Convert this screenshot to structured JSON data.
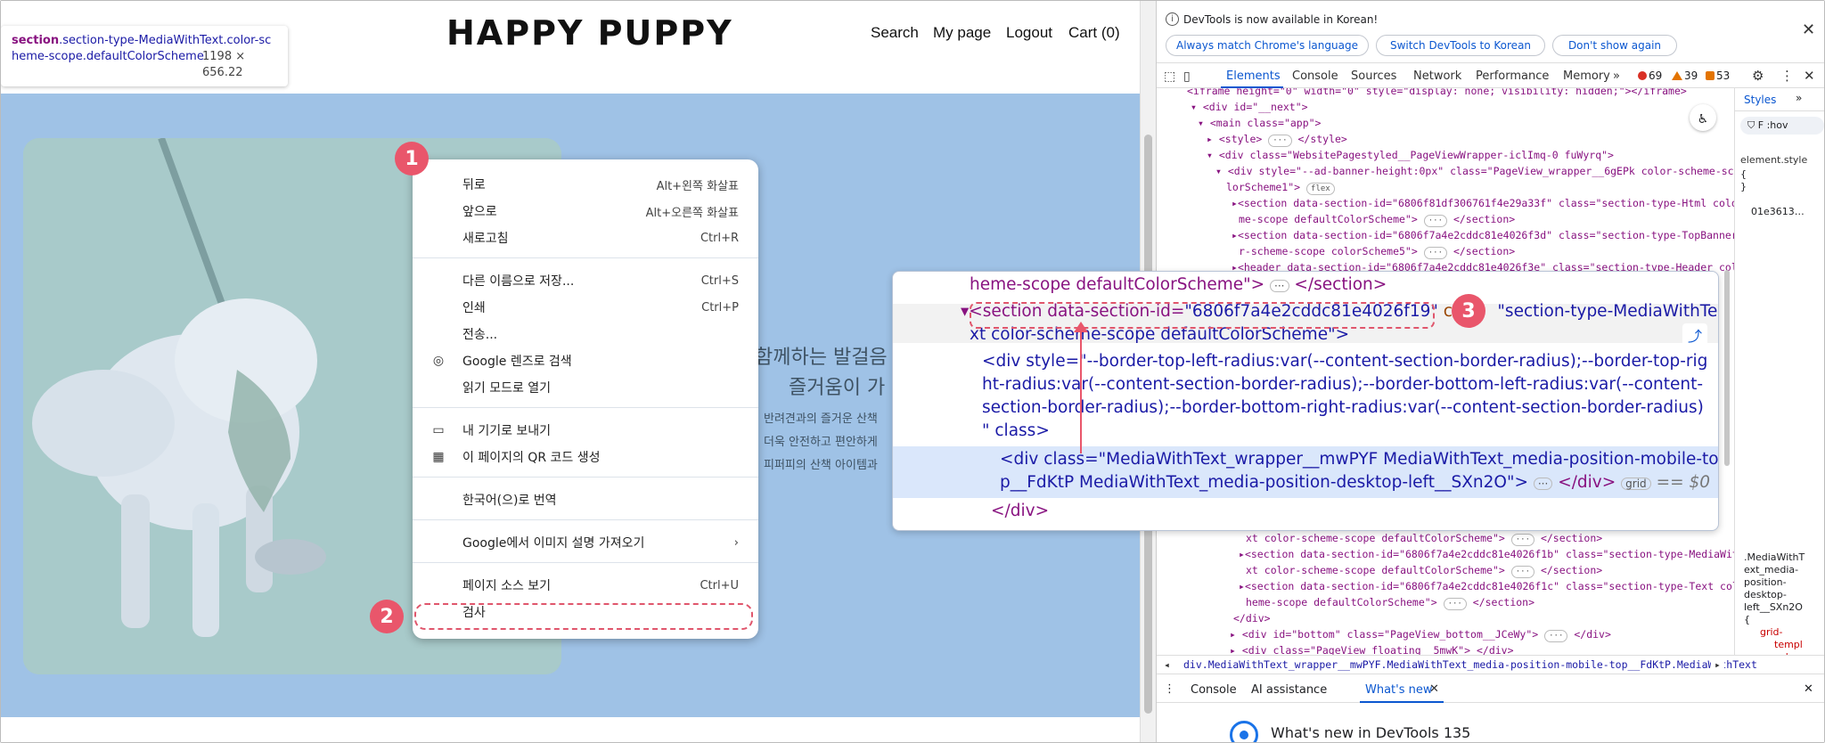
{
  "site": {
    "logo": "HAPPY PUPPY",
    "nav": {
      "search": "Search",
      "mypage": "My page",
      "logout": "Logout",
      "cart": "Cart (0)"
    },
    "hero_lines": [
      "함께하는 발걸음",
      "즐거움이 가",
      "반려견과의 즐거운 산책",
      "더욱 안전하고 편안하게",
      "피퍼피의 산책 아이템과"
    ],
    "inspect_tip": {
      "selector_tag": "section",
      "selector_rest": ".section-type-MediaWithText.color-scheme-scope.defaultColorScheme",
      "dims": "1198 × 656.22"
    }
  },
  "context_menu": {
    "items": [
      {
        "label": "뒤로",
        "shortcut": "Alt+왼쪽 화살표"
      },
      {
        "label": "앞으로",
        "shortcut": "Alt+오른쪽 화살표"
      },
      {
        "label": "새로고침",
        "shortcut": "Ctrl+R"
      },
      {
        "label": "다른 이름으로 저장...",
        "shortcut": "Ctrl+S"
      },
      {
        "label": "인쇄",
        "shortcut": "Ctrl+P"
      },
      {
        "label": "전송...",
        "shortcut": ""
      },
      {
        "label": "Google 렌즈로 검색",
        "shortcut": ""
      },
      {
        "label": "읽기 모드로 열기",
        "shortcut": ""
      },
      {
        "label": "내 기기로 보내기",
        "shortcut": ""
      },
      {
        "label": "이 페이지의 QR 코드 생성",
        "shortcut": ""
      },
      {
        "label": "한국어(으)로 번역",
        "shortcut": ""
      },
      {
        "label": "Google에서 이미지 설명 가져오기",
        "shortcut": "›"
      },
      {
        "label": "페이지 소스 보기",
        "shortcut": "Ctrl+U"
      },
      {
        "label": "검사",
        "shortcut": ""
      }
    ]
  },
  "steps": [
    "1",
    "2",
    "3"
  ],
  "devtools": {
    "infobar": {
      "message": "DevTools is now available in Korean!",
      "btn1": "Always match Chrome's language",
      "btn2": "Switch DevTools to Korean",
      "btn3": "Don't show again"
    },
    "tabs": [
      "Elements",
      "Console",
      "Sources",
      "Network",
      "Performance",
      "Memory"
    ],
    "counts": {
      "errors": "69",
      "warnings": "39",
      "issues": "53"
    },
    "styles_tab": "Styles",
    "styles_filter": "F",
    "styles_hov": ":hov",
    "styles_element": "element.style",
    "styles_brace_open": "{",
    "styles_brace_close": "}",
    "styles_hash": "01e3613…",
    "styles_rule2": [
      ".MediaWithT",
      "ext_media-",
      "position-",
      "desktop-",
      "left__SXn2O",
      "{",
      "grid-",
      "templ",
      "colum"
    ],
    "dom_lines": {
      "l1": "<iframe height=\"0\" width=\"0\" style=\"display: none; visibility: hidden;\"></iframe>",
      "l2_tag": "<div id=\"__next\">",
      "l3_tag": "<main class=\"app\">",
      "l4_tag": "<style>",
      "l4_end": "</style>",
      "l5_tag": "<div class=\"WebsitePagestyled__PageViewWrapper-iclImq-0 fuWyrq\">",
      "l6a": "<div style=\"--ad-banner-height:0px\" class=\"PageView_wrapper__6gEPk color-scheme-scope co",
      "l6b": "lorScheme1\">",
      "l6_chip": "flex",
      "l7a": "<section data-section-id=\"6806f81df306761f4e29a33f\" class=\"section-type-Html color-sche",
      "l7b": "me-scope defaultColorScheme\">",
      "l7_end": "</section>",
      "l8a": "<section data-section-id=\"6806f7a4e2cddc81e4026f3d\" class=\"section-type-TopBanner colo",
      "l8b": "r-scheme-scope colorScheme5\">",
      "l8_end": "</section>",
      "l9": "<header data-section-id=\"6806f7a4e2cddc81e4026f3e\" class=\"section-type-Header color-sch",
      "l10a": "xt color-scheme-scope defaultColorScheme\">",
      "l10_end": "</section>",
      "l11a": "<section data-section-id=\"6806f7a4e2cddc81e4026f1b\" class=\"section-type-MediaWithTe",
      "l11b": "xt color-scheme-scope defaultColorScheme\">",
      "l11_end": "</section>",
      "l12a": "<section data-section-id=\"6806f7a4e2cddc81e4026f1c\" class=\"section-type-Text color-sc",
      "l12b": "heme-scope defaultColorScheme\">",
      "l12_end": "</section>",
      "l13": "</div>",
      "l14": "<div id=\"bottom\" class=\"PageView_bottom__JCeWy\">",
      "l14_end": "</div>",
      "l15": "<div class=\"PageView_floating__5mwK\">",
      "l15_end": "</div>"
    },
    "breadcrumb": "div.MediaWithText_wrapper__mwPYF.MediaWithText_media-position-mobile-top__FdKtP.MediaWithText",
    "drawer_tabs": [
      "Console",
      "AI assistance",
      "What's new"
    ],
    "whats_new_title": "What's new in DevTools 135"
  },
  "zoom": {
    "z1": "heme-scope defaultColorScheme\">",
    "z1_end": "</section>",
    "z2_tag": "<section data-section-id=",
    "z2_val": "\"6806f7a4e2cddc81e4026f19\"",
    "z2_tail": "\"section-type-MediaWithTe",
    "z2_cls": "cla",
    "z3": "xt color-scheme-scope defaultColorScheme\">",
    "z4a": "<div style=\"--border-top-left-radius:var(--content-section-border-radius);--border-top-rig",
    "z4b": "ht-radius:var(--content-section-border-radius);--border-bottom-left-radius:var(--content-",
    "z4c": "section-border-radius);--border-bottom-right-radius:var(--content-section-border-radius)",
    "z4d": "\" class>",
    "z5a": "<div class=\"MediaWithText_wrapper__mwPYF MediaWithText_media-position-mobile-to",
    "z5b": "p__FdKtP MediaWithText_media-position-desktop-left__SXn2O\">",
    "z5_end": "</div>",
    "z5_chip": "grid",
    "z5_eq": "== $0",
    "z6": "</div>"
  }
}
